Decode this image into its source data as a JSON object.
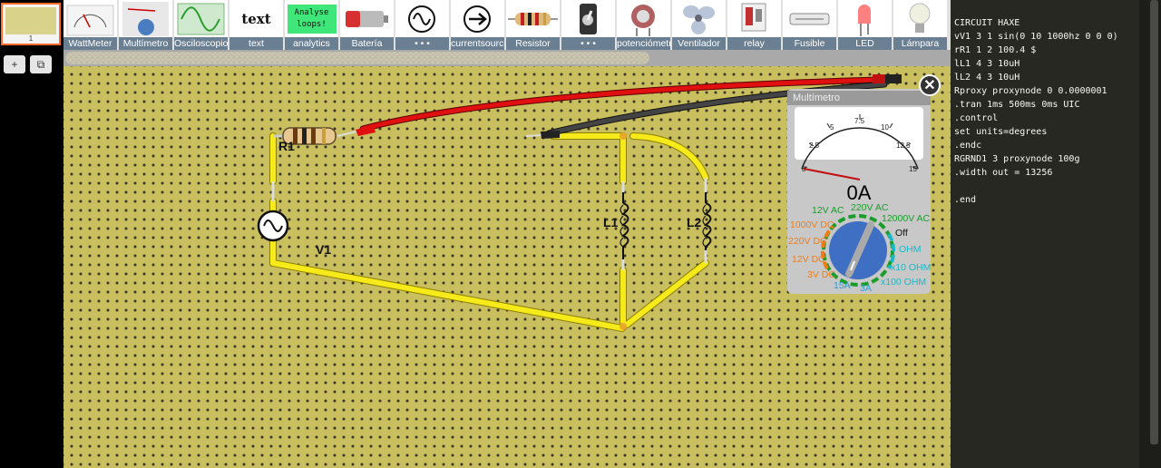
{
  "slides": {
    "current_number": "1",
    "add_label": "+",
    "copy_label": "⧉"
  },
  "toolbar": {
    "items": [
      {
        "label": "WattMeter",
        "icon": "wattmeter-icon"
      },
      {
        "label": "Multímetro",
        "icon": "multimeter-icon"
      },
      {
        "label": "Osciloscopio",
        "icon": "oscilloscope-icon"
      },
      {
        "label": "text",
        "icon_text": "text"
      },
      {
        "label": "analytics",
        "icon_text": "Analyse loops!"
      },
      {
        "label": "Batería",
        "icon": "battery-icon"
      },
      {
        "label": "• • •",
        "icon": "ac-source-icon"
      },
      {
        "label": "currentsource",
        "icon": "current-source-icon"
      },
      {
        "label": "Resistor",
        "icon": "resistor-icon"
      },
      {
        "label": "• • •",
        "icon": "switch-icon"
      },
      {
        "label": "potenciómetro",
        "icon": "potentiometer-icon"
      },
      {
        "label": "Ventilador",
        "icon": "fan-icon"
      },
      {
        "label": "relay",
        "icon": "relay-icon"
      },
      {
        "label": "Fusible",
        "icon": "fuse-icon"
      },
      {
        "label": "LED",
        "icon": "led-icon"
      },
      {
        "label": "Lámpara",
        "icon": "lamp-icon"
      }
    ]
  },
  "circuit": {
    "labels": {
      "r1": "R1",
      "v1": "V1",
      "l1": "L1",
      "l2": "L2"
    }
  },
  "multimeter": {
    "title": "Multímetro",
    "reading": "0A",
    "close_label": "✕",
    "scale_ticks": [
      "0",
      "2.5",
      "5",
      "7.5",
      "10",
      "12.5",
      "15"
    ],
    "dial_settings": [
      "12V AC",
      "220V AC",
      "12000V AC",
      "Off",
      "OHM",
      "x10 OHM",
      "x100 OHM",
      "3A",
      "15A",
      "3V DC",
      "12V DC",
      "220V DC",
      "1000V DC"
    ],
    "colors": {
      "ac": "#1a9c2a",
      "dc": "#f07c18",
      "ohm": "#19b8c8",
      "amp": "#2a9cd8"
    }
  },
  "netlist": {
    "lines": [
      "CIRCUIT HAXE",
      "vV1 3 1 sin(0 10 1000hz 0 0 0)",
      "rR1 1 2 100.4 $",
      "lL1 4 3 10uH",
      "lL2 4 3 10uH",
      "Rproxy proxynode 0 0.0000001",
      ".tran 1ms 500ms 0ms UIC",
      ".control",
      "set units=degrees",
      ".endc",
      "RGRND1 3 proxynode 100g",
      ".width out = 13256",
      "",
      ".end"
    ]
  }
}
